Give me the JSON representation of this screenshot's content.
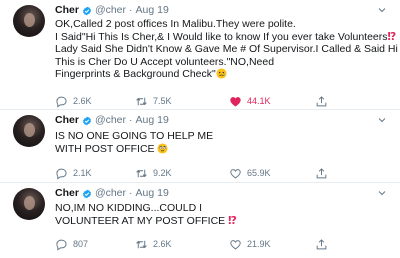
{
  "tweets": [
    {
      "author": {
        "name": "Cher",
        "handle": "@cher",
        "separator": "·",
        "date": "Aug 19"
      },
      "lines": [
        "OK,Called 2 post offices In Malibu.They were polite.",
        "I Said\"Hi This Is Cher,& I Would like to know If you ever take Volunteers",
        "Lady Said She Didn't Know & Gave Me # Of Supervisor.I Called & Said Hi",
        "This is Cher Do U Accept volunteers.\"NO,Need",
        "Fingerprints & Background Check\""
      ],
      "bang": "⁉",
      "stats": {
        "replies": "2.6K",
        "retweets": "7.5K",
        "likes": "44.1K",
        "liked": true
      }
    },
    {
      "author": {
        "name": "Cher",
        "handle": "@cher",
        "separator": "·",
        "date": "Aug 19"
      },
      "lines": [
        "IS NO ONE GOING TO HELP ME",
        "WITH POST OFFICE"
      ],
      "stats": {
        "replies": "2.1K",
        "retweets": "9.2K",
        "likes": "65.9K",
        "liked": false
      }
    },
    {
      "author": {
        "name": "Cher",
        "handle": "@cher",
        "separator": "·",
        "date": "Aug 19"
      },
      "lines": [
        "NO,IM NO KIDDING...COULD I",
        "VOLUNTEER AT MY POST OFFICE"
      ],
      "bang": "⁉",
      "stats": {
        "replies": "807",
        "retweets": "2.6K",
        "likes": "21.9K",
        "liked": false
      }
    }
  ],
  "colors": {
    "text": "#14171a",
    "secondary": "#657786",
    "verified": "#1da1f2",
    "like": "#e0245e",
    "divider": "#e6ecf0"
  },
  "icons": [
    "verified-badge-icon",
    "chevron-down-icon",
    "reply-icon",
    "retweet-icon",
    "heart-icon",
    "share-icon",
    "disappointed-face-icon",
    "rolling-eyes-face-icon"
  ]
}
